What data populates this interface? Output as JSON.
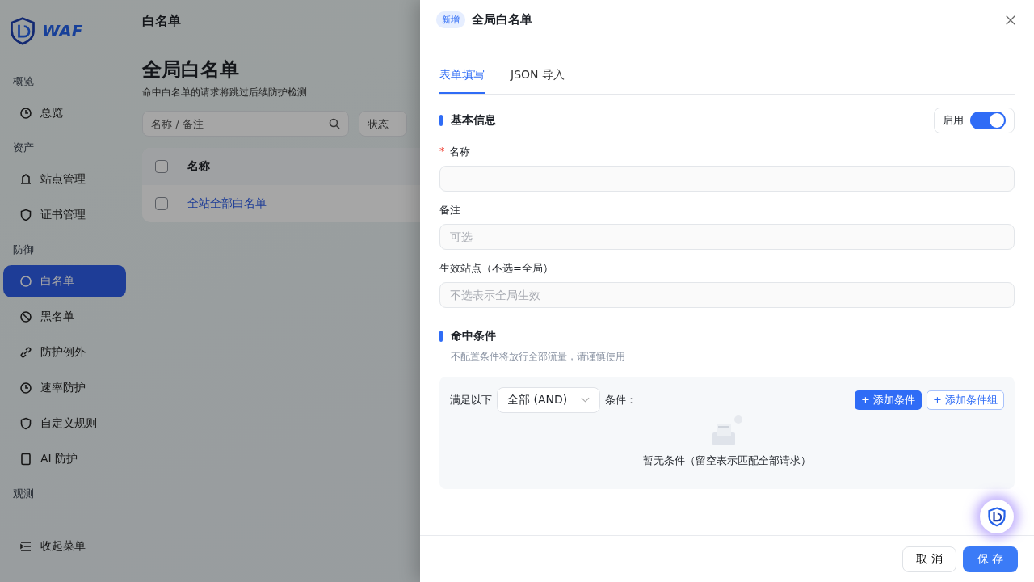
{
  "sidebar": {
    "logo": "WAF",
    "sections": [
      {
        "label": "概览",
        "items": [
          {
            "label": "总览",
            "selected": false
          }
        ]
      },
      {
        "label": "资产",
        "items": [
          {
            "label": "站点管理",
            "selected": false
          },
          {
            "label": "证书管理",
            "selected": false
          }
        ]
      },
      {
        "label": "防御",
        "items": [
          {
            "label": "白名单",
            "selected": true
          },
          {
            "label": "黑名单",
            "selected": false
          },
          {
            "label": "防护例外",
            "selected": false
          },
          {
            "label": "速率防护",
            "selected": false
          },
          {
            "label": "自定义规则",
            "selected": false
          },
          {
            "label": "AI 防护",
            "selected": false
          }
        ]
      },
      {
        "label": "观测"
      }
    ],
    "collapse": "收起菜单"
  },
  "header": {
    "title": "白名单"
  },
  "page": {
    "title": "全局白名单",
    "subtitle": "命中白名单的请求将跳过后续防护检测",
    "search": {
      "placeholder": "名称 / 备注"
    },
    "status_filter": {
      "placeholder": "状态"
    },
    "table": {
      "header_checked": false,
      "columns": [
        "名称"
      ],
      "rows": [
        {
          "name": "全站全部白名单",
          "checked": false
        }
      ]
    }
  },
  "drawer": {
    "badge": "新增",
    "title": "全局白名单",
    "tabs": [
      {
        "label": "表单填写",
        "selected": true
      },
      {
        "label": "JSON 导入",
        "selected": false
      }
    ],
    "basic": {
      "title": "基本信息",
      "enable": {
        "label": "启用",
        "on": true
      },
      "fields": [
        {
          "label": "名称",
          "required_mark": "*"
        },
        {
          "label": "备注",
          "placeholder": "可选"
        },
        {
          "label": "生效站点（不选=全局）",
          "placeholder": "不选表示全局生效"
        }
      ]
    },
    "conditions": {
      "title": "命中条件",
      "hint": "不配置条件将放行全部流量，请谨慎使用",
      "prefix": "满足以下",
      "mode": "全部 (AND)",
      "suffix": "条件：",
      "add_condition": "+ 添加条件",
      "add_group": "+ 添加条件组",
      "empty": "暂无条件（留空表示匹配全部请求）"
    },
    "footer": {
      "cancel": "取 消",
      "save": "保 存"
    }
  }
}
